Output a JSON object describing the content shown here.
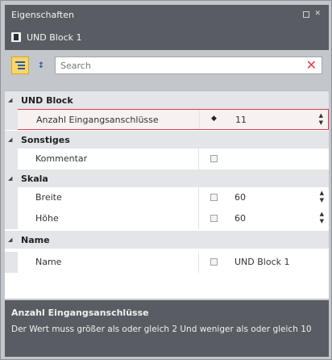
{
  "panel": {
    "title": "Eigenschaften",
    "object_name": "UND Block 1"
  },
  "toolbar": {
    "search_placeholder": "Search"
  },
  "grid": {
    "categories": [
      {
        "label": "UND Block",
        "properties": [
          {
            "name": "Anzahl Eingangsanschlüsse",
            "value": "11",
            "selected": true
          }
        ]
      },
      {
        "label": "Sonstiges",
        "properties": [
          {
            "name": "Kommentar",
            "value": ""
          }
        ]
      },
      {
        "label": "Skala",
        "properties": [
          {
            "name": "Breite",
            "value": "60"
          },
          {
            "name": "Höhe",
            "value": "60"
          }
        ]
      },
      {
        "label": "Name",
        "properties": [
          {
            "name": "Name",
            "value": "UND Block 1"
          }
        ]
      }
    ]
  },
  "description": {
    "title": "Anzahl Eingangsanschlüsse",
    "text": "Der Wert muss größer als oder gleich 2 Und weniger als oder gleich 10"
  },
  "colors": {
    "header_bg": "#595d63",
    "panel_bg": "#c3c6ca",
    "category_bg": "#e3e5e8",
    "selection_border": "#d6404a",
    "sort_button_bg": "#f9d56b"
  }
}
